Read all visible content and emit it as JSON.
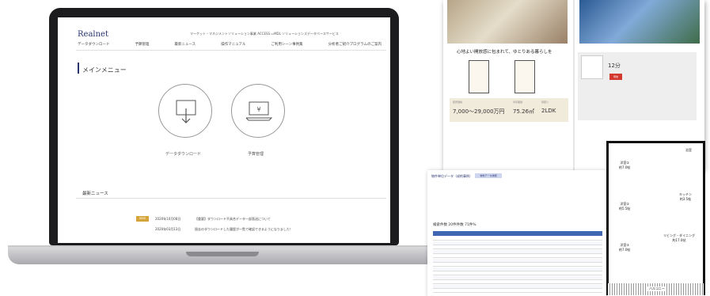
{
  "app": {
    "logo": "Realnet",
    "top_links": "マーケット・マネジメントソリューション事業 ACCESS  ▭MDL ソリューションズデータベースサービス",
    "nav": [
      "データダウンロード",
      "予算管理",
      "最新ニュース",
      "操作マニュアル",
      "ご利用シーン事例集",
      "分析者ご紹介プログラムのご案内"
    ],
    "menu_title": "メインメニュー",
    "menu_items": [
      {
        "label": "データダウンロード",
        "icon": "download-icon"
      },
      {
        "label": "予算管理",
        "icon": "budget-laptop-icon"
      }
    ],
    "news_title": "最新ニュース",
    "news": [
      {
        "tag": "NEW",
        "date": "2020年10月08日",
        "text": "【重要】ダウンロード不具合データ一部直送について"
      },
      {
        "tag": "",
        "date": "2020年03月13日",
        "text": "過去のダウンロードした履歴が一覧で確認できるようになりました！"
      }
    ]
  },
  "brochure": {
    "caption": "心地よい開放感に包まれて、ゆとりある暮らしを",
    "price_label": "販売価格",
    "price": "7,000〜29,000万円",
    "area_label": "専有面積",
    "area": "75.26㎡",
    "layout_label": "間取り",
    "layout": "2LDK",
    "station_badge": "12分",
    "map_pin": "現地"
  },
  "report": {
    "title": "物件単位データ（成約事例）",
    "badge": "物件データ詳細",
    "total": "検索件数 20件件数 71件%"
  },
  "floorplan": {
    "rooms": [
      {
        "name": "洋室①",
        "size": "約7.0帖"
      },
      {
        "name": "洋室②",
        "size": "約5.5帖"
      },
      {
        "name": "洋室③",
        "size": "約7.0帖"
      },
      {
        "name": "キッチン",
        "size": "約3.5帖"
      },
      {
        "name": "リビング・ダイニング",
        "size": "約17.0帖"
      },
      {
        "name": "浴室",
        "size": "1418"
      }
    ],
    "balcony": "バルコニー"
  },
  "colors": {
    "brand": "#2a3570",
    "accent": "#d6a53a",
    "table_header": "#3e66b3",
    "pin": "#d3392f"
  }
}
